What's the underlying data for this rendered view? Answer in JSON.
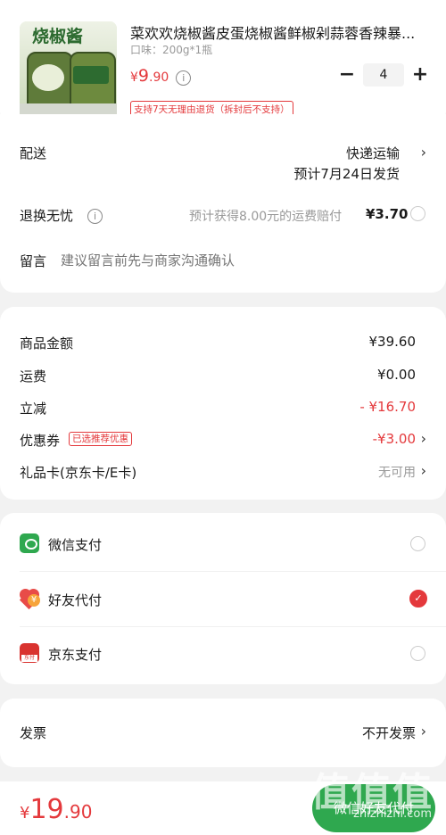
{
  "product": {
    "image_label": "烧椒酱",
    "name": "菜欢欢烧椒酱皮蛋烧椒酱鲜椒剁蒜蓉香辣暴...",
    "spec": "口味：200g*1瓶",
    "price_symbol": "¥",
    "price_int": "9",
    "price_dec": ".90",
    "info_icon": "info-icon",
    "quantity": "4",
    "minus": "−",
    "plus": "+",
    "tag": "支持7天无理由退货（拆封后不支持）"
  },
  "delivery": {
    "label": "配送",
    "method": "快递运输",
    "eta": "预计7月24日发货"
  },
  "return_insurance": {
    "label": "退换无忧",
    "desc": "预计获得8.00元的运费赔付",
    "price": "¥3.70"
  },
  "message": {
    "label": "留言",
    "placeholder": "建议留言前先与商家沟通确认"
  },
  "summary": {
    "goods_label": "商品金额",
    "goods_value": "¥39.60",
    "shipping_label": "运费",
    "shipping_value": "¥0.00",
    "discount_label": "立减",
    "discount_value": "- ¥16.70",
    "coupon_label": "优惠券",
    "coupon_badge": "已选推荐优惠",
    "coupon_value": "-¥3.00",
    "giftcard_label": "礼品卡(京东卡/E卡)",
    "giftcard_value": "无可用"
  },
  "payment": {
    "wechat": "微信支付",
    "friend": "好友代付",
    "jd": "京东支付",
    "jd_icon_text": "东付",
    "friend_icon_text": "¥",
    "selected": "friend"
  },
  "invoice": {
    "label": "发票",
    "value": "不开发票"
  },
  "footer": {
    "price_symbol": "¥",
    "price_int": "19",
    "price_dec": ".90",
    "pay_button": "微信好友代付",
    "watermark": "值值值",
    "watermark_url": "zhizhizhi.com"
  },
  "colors": {
    "accent": "#e4393c",
    "wechat_green": "#2fa84f"
  }
}
